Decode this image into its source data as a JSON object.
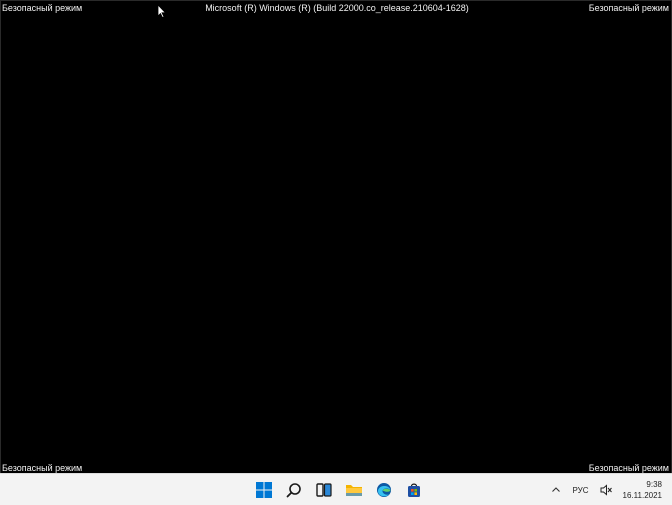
{
  "safe_mode": {
    "top_left": "Безопасный режим",
    "top_right": "Безопасный режим",
    "bottom_left": "Безопасный режим",
    "bottom_right": "Безопасный режим"
  },
  "build_info": "Microsoft (R) Windows (R) (Build 22000.co_release.210604-1628)",
  "taskbar": {
    "pinned": [
      {
        "name": "start",
        "icon": "windows-logo-icon"
      },
      {
        "name": "search",
        "icon": "search-icon"
      },
      {
        "name": "task-view",
        "icon": "task-view-icon"
      },
      {
        "name": "file-explorer",
        "icon": "folder-icon"
      },
      {
        "name": "edge",
        "icon": "edge-icon"
      },
      {
        "name": "store",
        "icon": "store-icon"
      }
    ],
    "tray": {
      "language": "РУС",
      "time": "9:38",
      "date": "16.11.2021"
    }
  },
  "colors": {
    "background": "#000000",
    "taskbar": "#f3f3f3",
    "windows_blue": "#0078d4"
  }
}
